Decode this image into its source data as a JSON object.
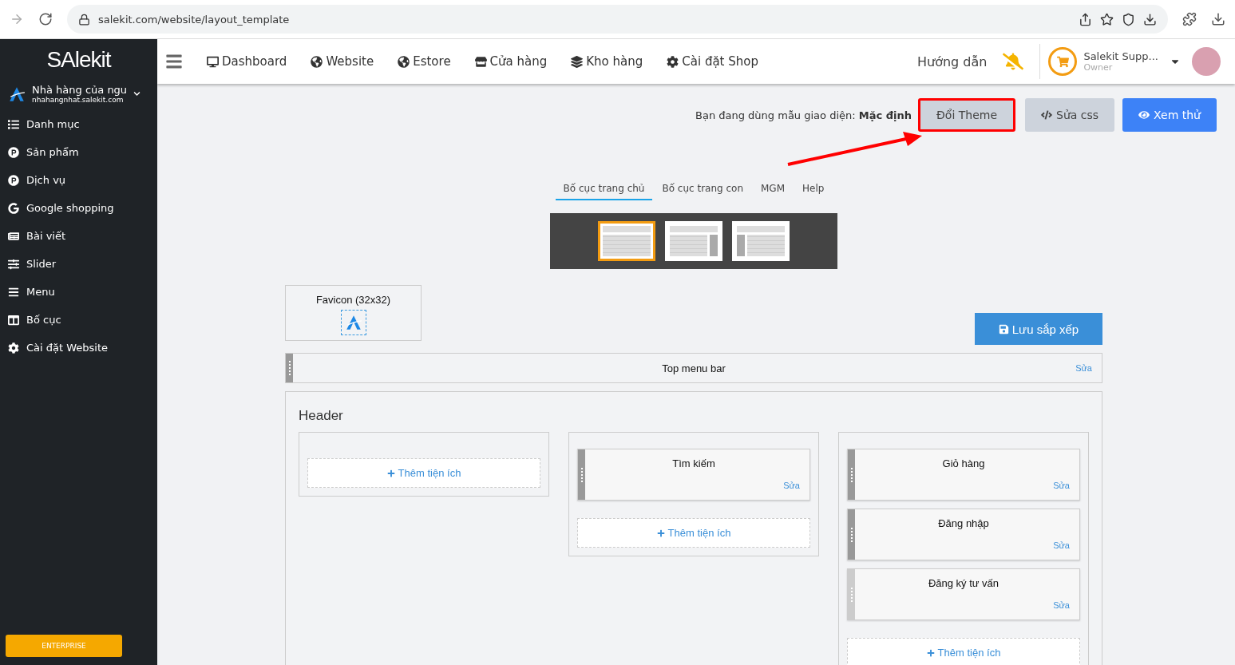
{
  "browser": {
    "url": "salekit.com/website/layout_template"
  },
  "sidebar": {
    "logo": "SAlekit",
    "shop_name": "Nhà hàng của ngu",
    "shop_domain": "nhahangnhat.salekit.com",
    "items": [
      {
        "label": "Danh mục",
        "kind": "list"
      },
      {
        "label": "Sản phẩm",
        "kind": "p"
      },
      {
        "label": "Dịch vụ",
        "kind": "p"
      },
      {
        "label": "Google shopping",
        "kind": "google"
      },
      {
        "label": "Bài viết",
        "kind": "news"
      },
      {
        "label": "Slider",
        "kind": "sliders"
      },
      {
        "label": "Menu",
        "kind": "bars"
      },
      {
        "label": "Bố cục",
        "kind": "columns"
      },
      {
        "label": "Cài đặt Website",
        "kind": "gear"
      }
    ],
    "plan": "ENTERPRISE"
  },
  "topnav": {
    "items": [
      {
        "label": "Dashboard",
        "kind": "desktop"
      },
      {
        "label": "Website",
        "kind": "globe"
      },
      {
        "label": "Estore",
        "kind": "globe"
      },
      {
        "label": "Cửa hàng",
        "kind": "store"
      },
      {
        "label": "Kho hàng",
        "kind": "layers"
      },
      {
        "label": "Cài đặt Shop",
        "kind": "gear"
      }
    ],
    "help": "Hướng dẫn",
    "user_name": "Salekit Supp...",
    "user_role": "Owner"
  },
  "theme_bar": {
    "text": "Bạn đang dùng mẫu giao diện: **Mặc định**",
    "buttons": [
      {
        "label": "Đổi Theme",
        "kind": "theme",
        "highlighted": true
      },
      {
        "label": "Sửa css",
        "kind": "css",
        "highlighted": false
      },
      {
        "label": "Xem thử",
        "kind": "preview",
        "highlighted": false
      }
    ]
  },
  "tabs": [
    {
      "label": "Bố cục trang chủ",
      "selected": true
    },
    {
      "label": "Bố cục trang con",
      "selected": false
    },
    {
      "label": "MGM",
      "selected": false
    },
    {
      "label": "Help",
      "selected": false
    }
  ],
  "layouts": [
    {
      "kind": "full",
      "selected": true
    },
    {
      "kind": "right",
      "selected": false
    },
    {
      "kind": "left",
      "selected": false
    }
  ],
  "favicon": {
    "label": "Favicon (32x32)"
  },
  "save_button": "Lưu sắp xếp",
  "top_bar": {
    "label": "Top menu bar",
    "edit": "Sửa"
  },
  "header": {
    "title": "Header",
    "columns": [
      {
        "add": "Thêm tiện ích"
      },
      {
        "widgets": [
          {
            "label": "Tìm kiếm",
            "edit": "Sửa",
            "active": true
          }
        ],
        "add": "Thêm tiện ích"
      },
      {
        "widgets": [
          {
            "label": "Giỏ hàng",
            "edit": "Sửa",
            "active": true
          },
          {
            "label": "Đăng nhập",
            "edit": "Sửa",
            "active": true
          },
          {
            "label": "Đăng ký tư vấn",
            "edit": "Sửa",
            "active": false
          }
        ],
        "add": "Thêm tiện ích"
      }
    ]
  }
}
